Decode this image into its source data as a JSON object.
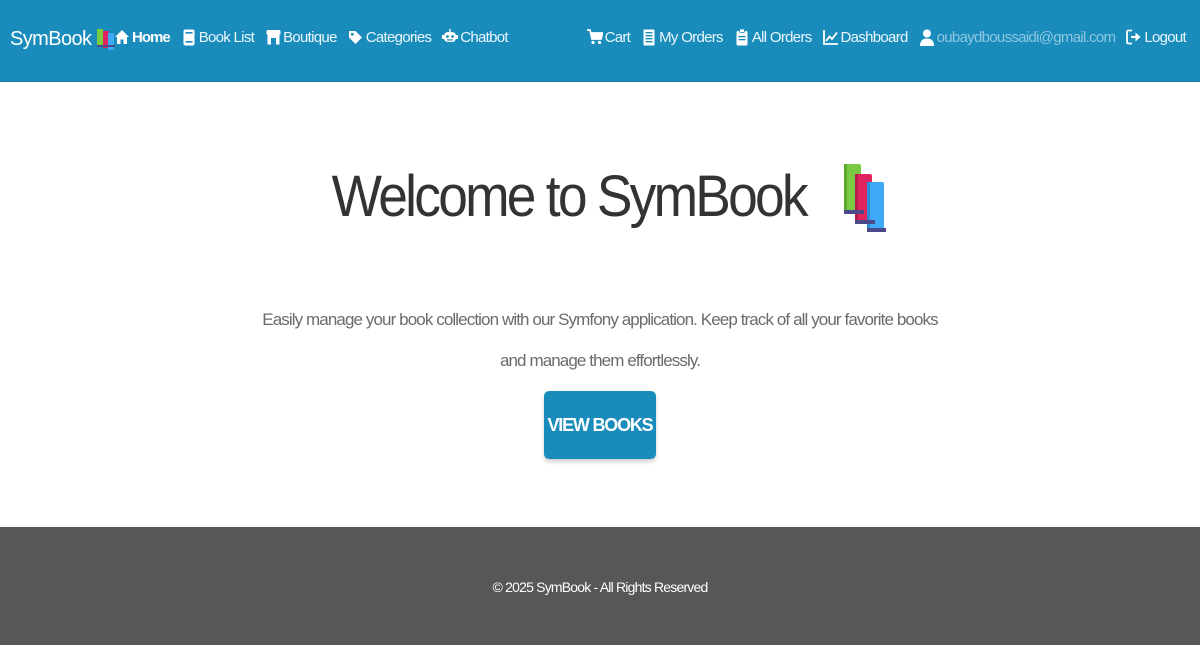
{
  "navbar": {
    "brand": "SymBook",
    "brand_icon": "books-icon",
    "left_items": [
      {
        "label": "Home",
        "icon": "home-icon",
        "active": true
      },
      {
        "label": "Book List",
        "icon": "book-icon"
      },
      {
        "label": "Boutique",
        "icon": "store-icon"
      },
      {
        "label": "Categories",
        "icon": "tag-icon"
      },
      {
        "label": "Chatbot",
        "icon": "robot-icon"
      }
    ],
    "right_items": [
      {
        "label": "Cart",
        "icon": "cart-icon"
      },
      {
        "label": "My Orders",
        "icon": "receipt-icon"
      },
      {
        "label": "All Orders",
        "icon": "clipboard-icon"
      },
      {
        "label": "Dashboard",
        "icon": "chart-line-icon"
      },
      {
        "label": "oubaydboussaidi@gmail.com",
        "icon": "user-icon"
      },
      {
        "label": "Logout",
        "icon": "logout-icon"
      }
    ]
  },
  "hero": {
    "title": "Welcome to SymBook",
    "title_icon": "books-icon",
    "lead": "Easily manage your book collection with our Symfony application. Keep track of all your favorite books and manage them effortlessly.",
    "button_label": "VIEW BOOKS"
  },
  "footer": {
    "text": "© 2025 SymBook - All Rights Reserved"
  },
  "colors": {
    "primary": "#1a8cbc",
    "footer_bg": "#575757",
    "muted_email": "#8fc7e0"
  }
}
